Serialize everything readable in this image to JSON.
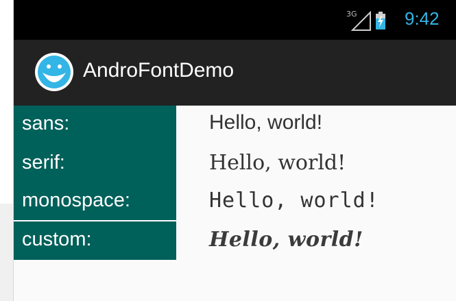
{
  "status_bar": {
    "network": "3G",
    "time": "9:42",
    "accent_color": "#33b5e5",
    "icons": [
      "signal-icon",
      "battery-charging-icon"
    ]
  },
  "action_bar": {
    "app_title": "AndroFontDemo",
    "icon": "app-smiley-icon"
  },
  "rows": [
    {
      "label": "sans:",
      "sample": "Hello, world!"
    },
    {
      "label": "serif:",
      "sample": "Hello, world!"
    },
    {
      "label": "monospace:",
      "sample": "Hello, world!"
    },
    {
      "label": "custom:",
      "sample": "Hello, world!"
    }
  ],
  "colors": {
    "label_background": "#00605a",
    "action_bar": "#222222",
    "status_bar": "#000000"
  }
}
